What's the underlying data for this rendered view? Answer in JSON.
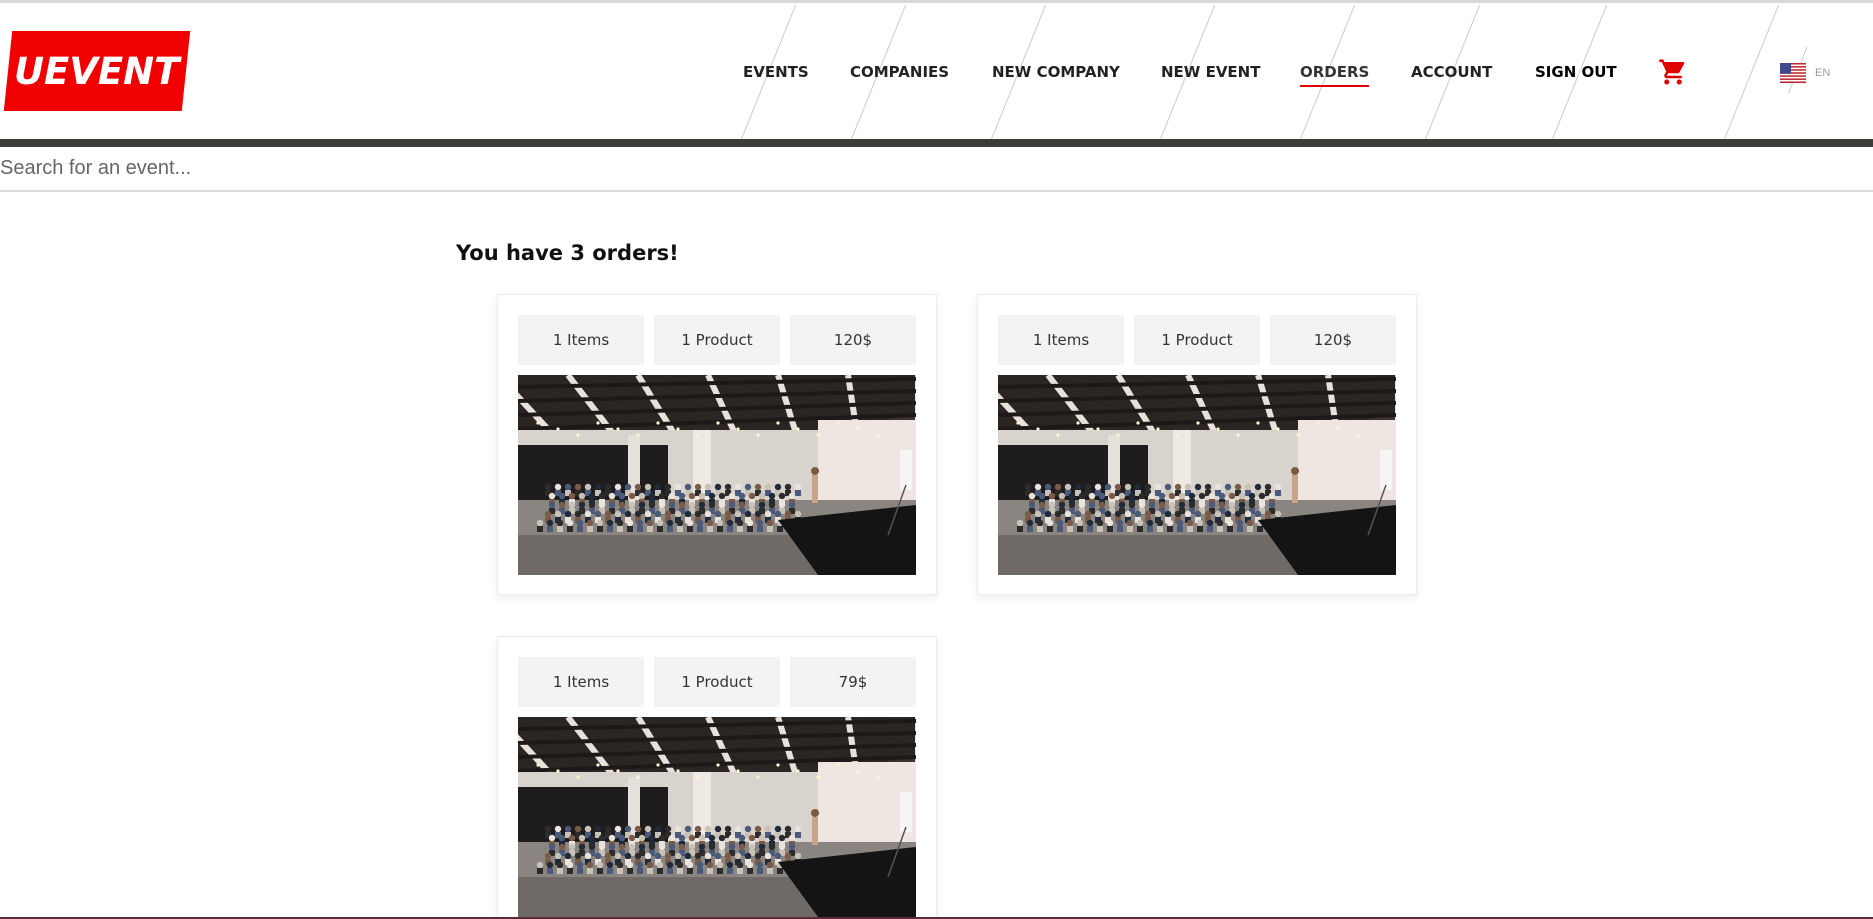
{
  "brand": {
    "logo_text": "UEVENT",
    "accent_color": "#f00000"
  },
  "nav": {
    "items": [
      {
        "label": "EVENTS"
      },
      {
        "label": "COMPANIES"
      },
      {
        "label": "NEW COMPANY"
      },
      {
        "label": "NEW EVENT"
      },
      {
        "label": "ORDERS",
        "active": true
      },
      {
        "label": "ACCOUNT"
      },
      {
        "label": "SIGN OUT"
      }
    ],
    "cart_icon": "cart-icon",
    "language": {
      "flag_icon": "us-flag-icon",
      "label": "EN"
    }
  },
  "search": {
    "placeholder": "Search for an event...",
    "value": ""
  },
  "orders": {
    "heading": "You have 3 orders!",
    "list": [
      {
        "items": "1 Items",
        "products": "1 Product",
        "total": "120$",
        "image_icon": "event-photo"
      },
      {
        "items": "1 Items",
        "products": "1 Product",
        "total": "120$",
        "image_icon": "event-photo"
      },
      {
        "items": "1 Items",
        "products": "1 Product",
        "total": "79$",
        "image_icon": "event-photo"
      }
    ]
  }
}
